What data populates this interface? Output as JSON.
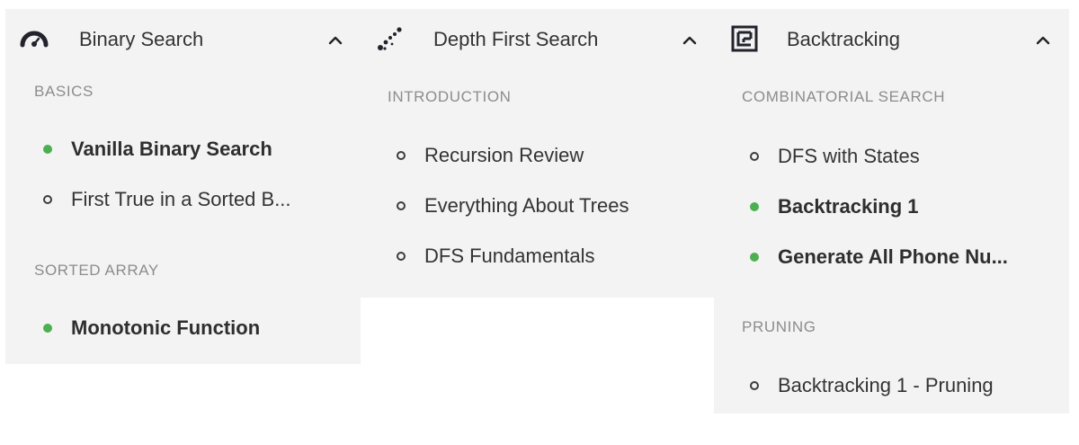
{
  "panels": [
    {
      "title": "Binary Search",
      "icon": "gauge-icon",
      "sections": [
        {
          "title": "BASICS",
          "items": [
            {
              "label": "Vanilla Binary Search",
              "completed": true
            },
            {
              "label": "First True in a Sorted B...",
              "completed": false
            }
          ]
        },
        {
          "title": "SORTED ARRAY",
          "items": [
            {
              "label": "Monotonic Function",
              "completed": true
            }
          ]
        }
      ]
    },
    {
      "title": "Depth First Search",
      "icon": "dotted-path-icon",
      "sections": [
        {
          "title": "INTRODUCTION",
          "items": [
            {
              "label": "Recursion Review",
              "completed": false
            },
            {
              "label": "Everything About Trees",
              "completed": false
            },
            {
              "label": "DFS Fundamentals",
              "completed": false
            }
          ]
        }
      ]
    },
    {
      "title": "Backtracking",
      "icon": "maze-icon",
      "sections": [
        {
          "title": "COMBINATORIAL SEARCH",
          "items": [
            {
              "label": "DFS with States",
              "completed": false
            },
            {
              "label": "Backtracking 1",
              "completed": true
            },
            {
              "label": "Generate All Phone Nu...",
              "completed": true
            }
          ]
        },
        {
          "title": "PRUNING",
          "items": [
            {
              "label": "Backtracking 1 - Pruning",
              "completed": false
            }
          ]
        }
      ]
    }
  ],
  "colors": {
    "panel_bg": "#f3f3f3",
    "completed": "#4caf50",
    "text": "#333333",
    "section_title": "#8c8c8c"
  }
}
